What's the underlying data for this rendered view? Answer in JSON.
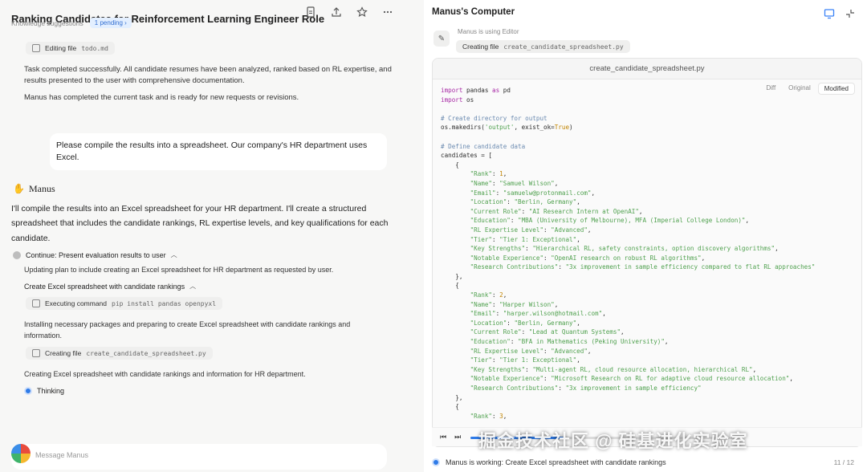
{
  "left": {
    "title": "Ranking Candidates for Reinforcement Learning Engineer Role",
    "kb_label": "Knowledge suggestions",
    "kb_pill": "1 pending",
    "step_editing": {
      "label": "Editing file",
      "file": "todo.md"
    },
    "completed_para": "Task completed successfully. All candidate resumes have been analyzed, ranked based on RL expertise, and results presented to the user with comprehensive documentation.",
    "ready_para": "Manus has completed the current task and is ready for new requests or revisions.",
    "user_message": "Please compile the results into a spreadsheet. Our company's HR department uses Excel.",
    "agent_name": "Manus",
    "agent_reply": "I'll compile the results into an Excel spreadsheet for your HR department. I'll create a structured spreadsheet that includes the candidate rankings, RL expertise levels, and key qualifications for each candidate.",
    "plan1": "Continue: Present evaluation results to user",
    "plan1_detail": "Updating plan to include creating an Excel spreadsheet for HR department as requested by user.",
    "plan2": "Create Excel spreadsheet with candidate rankings",
    "step_exec": {
      "label": "Executing command",
      "cmd": "pip install pandas openpyxl"
    },
    "install_para": "Installing necessary packages and preparing to create Excel spreadsheet with candidate rankings and information.",
    "step_create": {
      "label": "Creating file",
      "file": "create_candidate_spreadsheet.py"
    },
    "creating_para": "Creating Excel spreadsheet with candidate rankings and information for HR department.",
    "thinking": "Thinking",
    "composer_placeholder": "Message Manus"
  },
  "right": {
    "header": "Manus's Computer",
    "using_label": "Manus is using Editor",
    "chip": {
      "label": "Creating file",
      "file": "create_candidate_spreadsheet.py"
    },
    "editor_title": "create_candidate_spreadsheet.py",
    "tabs": [
      "Diff",
      "Original",
      "Modified"
    ],
    "active_tab": "Modified",
    "progress": 0.35,
    "status": "Manus is working: Create Excel spreadsheet with candidate rankings",
    "page": "11 / 12"
  },
  "code_lines": [
    "import pandas as pd",
    "import os",
    "",
    "# Create directory for output",
    "os.makedirs('output', exist_ok=True)",
    "",
    "# Define candidate data",
    "candidates = [",
    "    {",
    "        \"Rank\": 1,",
    "        \"Name\": \"Samuel Wilson\",",
    "        \"Email\": \"samuelw@protonmail.com\",",
    "        \"Location\": \"Berlin, Germany\",",
    "        \"Current Role\": \"AI Research Intern at OpenAI\",",
    "        \"Education\": \"MBA (University of Melbourne), MFA (Imperial College London)\",",
    "        \"RL Expertise Level\": \"Advanced\",",
    "        \"Tier\": \"Tier 1: Exceptional\",",
    "        \"Key Strengths\": \"Hierarchical RL, safety constraints, option discovery algorithms\",",
    "        \"Notable Experience\": \"OpenAI research on robust RL algorithms\",",
    "        \"Research Contributions\": \"3x improvement in sample efficiency compared to flat RL approaches\"",
    "    },",
    "    {",
    "        \"Rank\": 2,",
    "        \"Name\": \"Harper Wilson\",",
    "        \"Email\": \"harper.wilson@hotmail.com\",",
    "        \"Location\": \"Berlin, Germany\",",
    "        \"Current Role\": \"Lead at Quantum Systems\",",
    "        \"Education\": \"BFA in Mathematics (Peking University)\",",
    "        \"RL Expertise Level\": \"Advanced\",",
    "        \"Tier\": \"Tier 1: Exceptional\",",
    "        \"Key Strengths\": \"Multi-agent RL, cloud resource allocation, hierarchical RL\",",
    "        \"Notable Experience\": \"Microsoft Research on RL for adaptive cloud resource allocation\",",
    "        \"Research Contributions\": \"3x improvement in sample efficiency\"",
    "    },",
    "    {",
    "        \"Rank\": 3,"
  ],
  "watermark": "掘金技术社区 @ 硅基进化实验室"
}
